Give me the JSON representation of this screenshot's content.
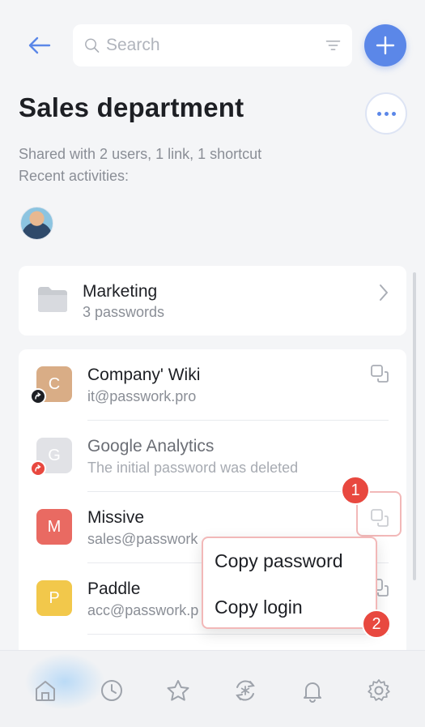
{
  "header": {
    "search_placeholder": "Search",
    "title": "Sales department",
    "shared_info": "Shared with 2 users, 1 link, 1 shortcut",
    "recent_label": "Recent activities:"
  },
  "folder": {
    "name": "Marketing",
    "count": "3 passwords"
  },
  "items": [
    {
      "letter": "C",
      "name": "Company' Wiki",
      "sub": "it@passwork.pro",
      "color": "#d9ad86",
      "share_color": "#1d1f24"
    },
    {
      "letter": "G",
      "name": "Google Analytics",
      "sub": "The initial password was deleted",
      "color": "#c9ccd3",
      "share_color": "#e8483f"
    },
    {
      "letter": "M",
      "name": "Missive",
      "sub": "sales@passwork",
      "color": "#e96a62"
    },
    {
      "letter": "P",
      "name": "Paddle",
      "sub": "acc@passwork.p",
      "color": "#f2c84b"
    }
  ],
  "copy_menu": {
    "copy_password": "Copy password",
    "copy_login": "Copy login"
  },
  "badges": {
    "first": "1",
    "second": "2"
  },
  "colors": {
    "accent": "#5b87e8",
    "badge": "#e8483f"
  },
  "nav": [
    "home-icon",
    "clock-icon",
    "star-icon",
    "sync-icon",
    "bell-icon",
    "gear-icon"
  ]
}
